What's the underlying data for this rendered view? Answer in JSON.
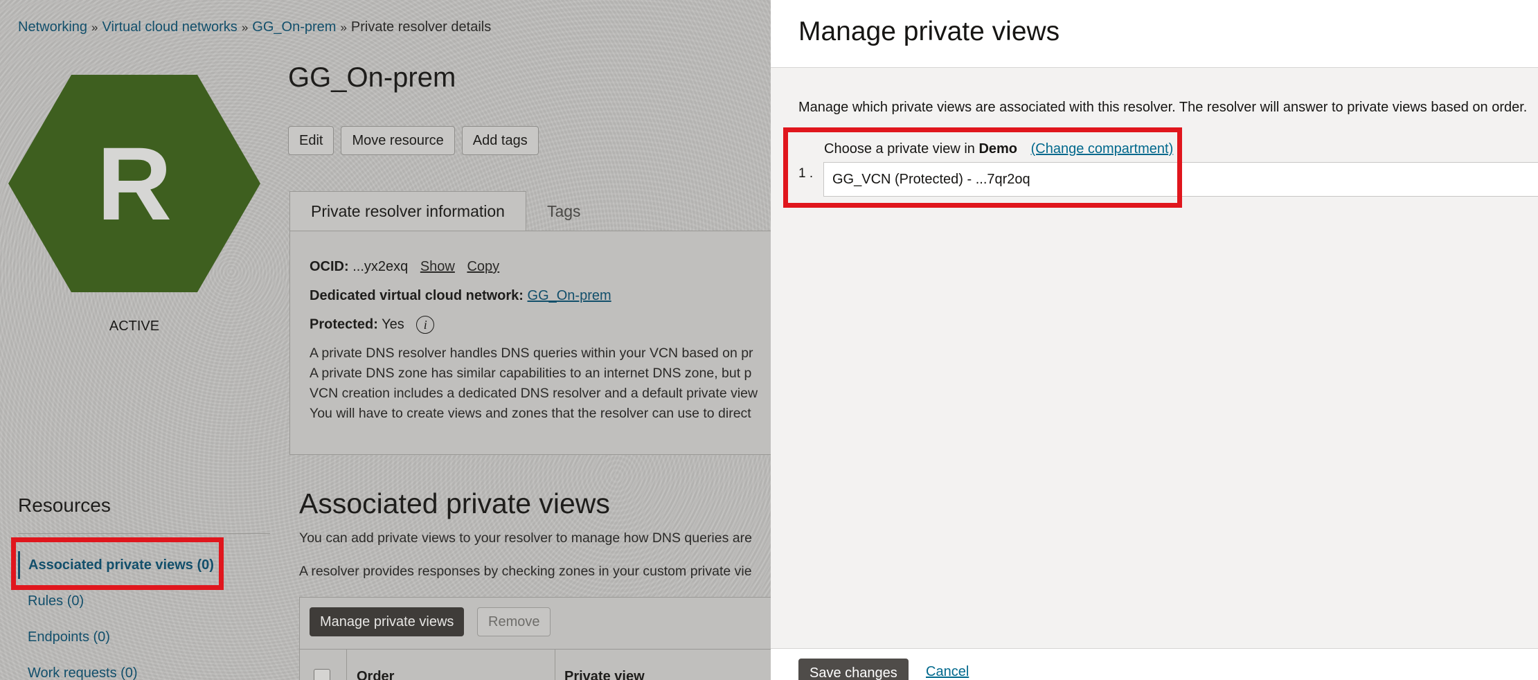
{
  "breadcrumb": {
    "items": [
      "Networking",
      "Virtual cloud networks",
      "GG_On-prem"
    ],
    "current": "Private resolver details",
    "separator": "»"
  },
  "resource": {
    "icon_letter": "R",
    "icon_color": "#3e5f1f",
    "state": "ACTIVE",
    "title": "GG_On-prem"
  },
  "actions": {
    "edit": "Edit",
    "move": "Move resource",
    "add_tags": "Add tags"
  },
  "tabs": [
    {
      "label": "Private resolver information",
      "active": true
    },
    {
      "label": "Tags",
      "active": false
    }
  ],
  "info": {
    "ocid_label": "OCID:",
    "ocid_value": "...yx2exq",
    "show": "Show",
    "copy": "Copy",
    "vcn_label": "Dedicated virtual cloud network:",
    "vcn_value": "GG_On-prem",
    "protected_label": "Protected:",
    "protected_value": "Yes",
    "description": [
      "A private DNS resolver handles DNS queries within your VCN based on pr",
      "A private DNS zone has similar capabilities to an internet DNS zone, but p",
      "VCN creation includes a dedicated DNS resolver and a default private view",
      "You will have to create views and zones that the resolver can use to direct"
    ]
  },
  "resources": {
    "title": "Resources",
    "items": [
      {
        "label": "Associated private views (0)",
        "active": true
      },
      {
        "label": "Rules (0)",
        "active": false
      },
      {
        "label": "Endpoints (0)",
        "active": false
      },
      {
        "label": "Work requests (0)",
        "active": false
      }
    ]
  },
  "associated": {
    "title": "Associated private views",
    "desc1": "You can add private views to your resolver to manage how DNS queries are",
    "desc2": "A resolver provides responses by checking zones in your custom private vie",
    "manage_button": "Manage private views",
    "remove_button": "Remove",
    "columns": [
      "Order",
      "Private view"
    ]
  },
  "panel": {
    "title": "Manage private views",
    "description": "Manage which private views are associated with this resolver. The resolver will answer to private views based on order.",
    "row_number": "1 .",
    "choose_prefix": "Choose a private view in",
    "compartment": "Demo",
    "change_compartment": "(Change compartment)",
    "selected_view": "GG_VCN (Protected) - ...7qr2oq",
    "save": "Save changes",
    "cancel": "Cancel"
  },
  "colors": {
    "highlight": "#e0161d",
    "link": "#00688c",
    "hexagon": "#3e5f1f"
  }
}
